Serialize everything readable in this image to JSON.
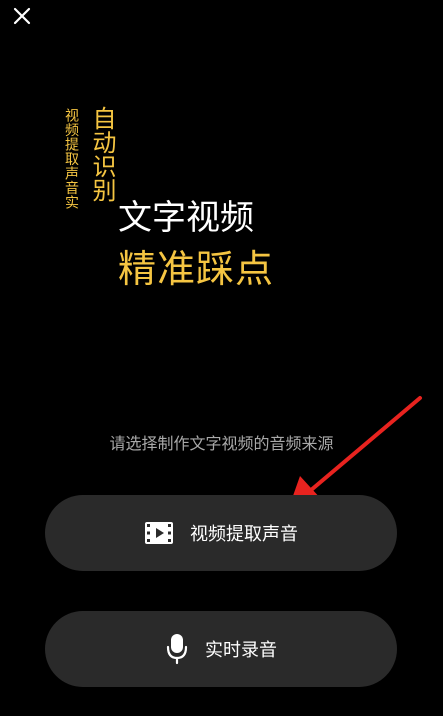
{
  "colors": {
    "background": "#000000",
    "accent_yellow": "#F5C542",
    "pill_bg": "#2a2a2a",
    "prompt_text": "#a9a9a9",
    "arrow_red": "#E8231F"
  },
  "header": {
    "close_icon": "close-icon"
  },
  "hero": {
    "vertical_small": "视频提取声音实",
    "vertical_large": "自动识别",
    "title_line1": "文字视频",
    "title_line2": "精准踩点"
  },
  "prompt": "请选择制作文字视频的音频来源",
  "options": [
    {
      "label": "视频提取声音",
      "icon": "video-file-icon"
    },
    {
      "label": "实时录音",
      "icon": "microphone-icon"
    }
  ]
}
